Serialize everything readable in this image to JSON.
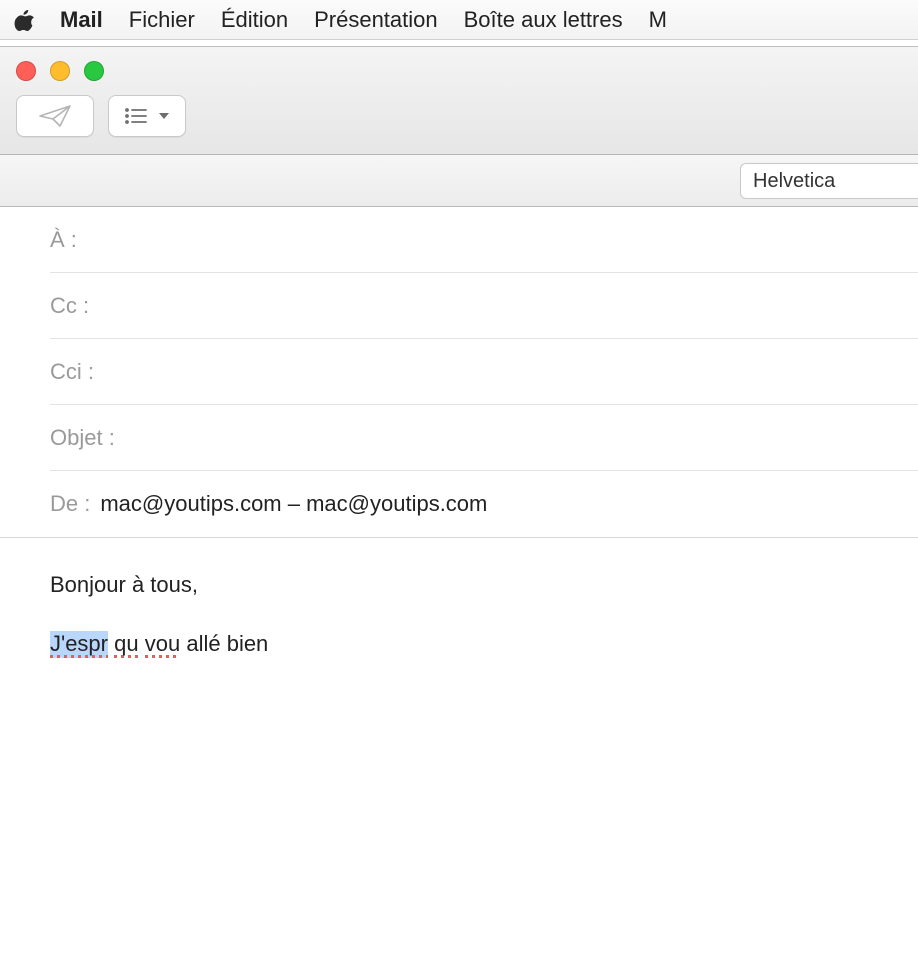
{
  "menubar": {
    "app": "Mail",
    "items": [
      "Fichier",
      "Édition",
      "Présentation",
      "Boîte aux lettres",
      "M"
    ]
  },
  "compose": {
    "font": "Helvetica",
    "fields": {
      "to_label": "À :",
      "cc_label": "Cc :",
      "bcc_label": "Cci :",
      "subject_label": "Objet :",
      "from_label": "De :",
      "from_value": "mac@youtips.com – mac@youtips.com"
    },
    "body": {
      "line1": "Bonjour à tous,",
      "w1": "J'espr",
      "w2": "qu",
      "w3": "vou",
      "rest": " allé bien"
    }
  }
}
